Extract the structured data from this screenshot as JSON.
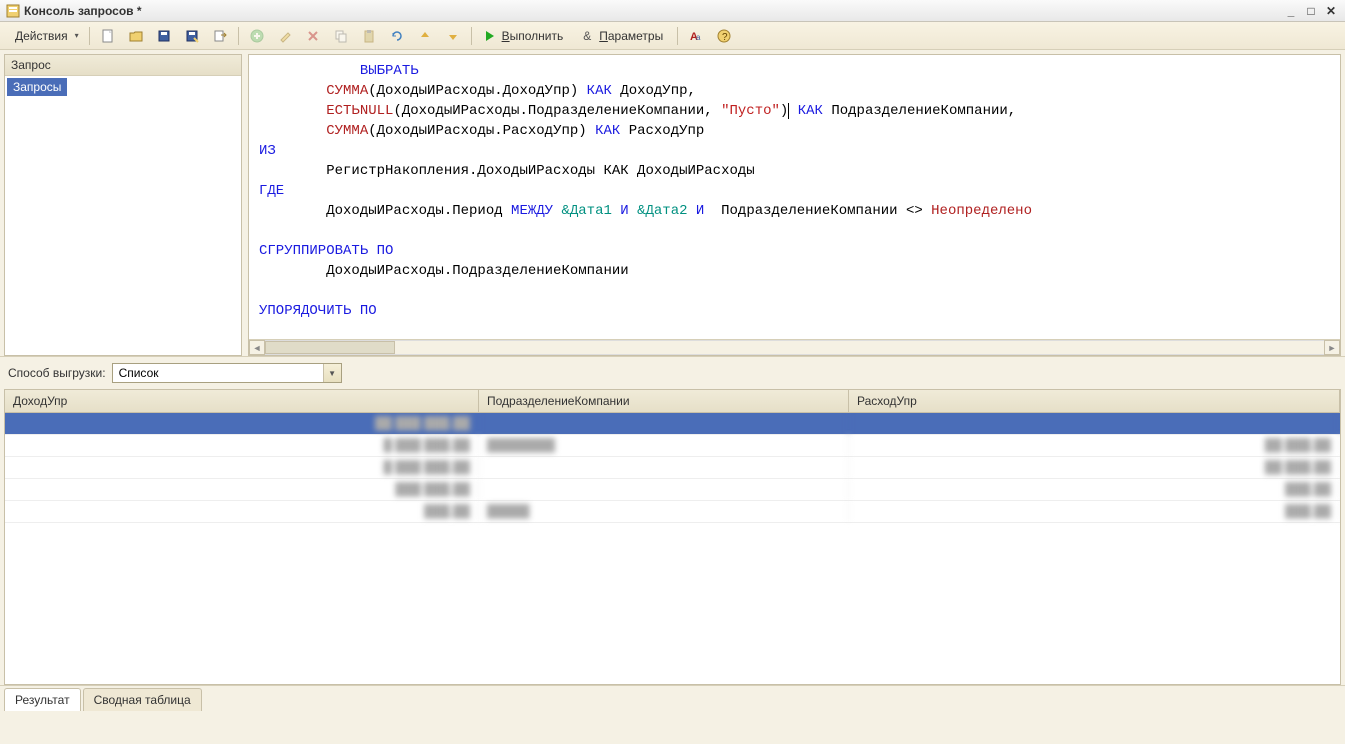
{
  "window": {
    "title": "Консоль запросов *"
  },
  "toolbar": {
    "actions_label": "Действия",
    "execute_label": "Выполнить",
    "params_label": "Параметры"
  },
  "tree": {
    "header": "Запрос",
    "item_0": "Запросы"
  },
  "query": {
    "line1_indent": "            ",
    "select_kw": "ВЫБРАТЬ",
    "sum_fn": "СУММА",
    "isnull_fn": "ЕСТЬNULL",
    "line2_indent": "        ",
    "line2_arg": "(ДоходыИРасходы.ДоходУпр) ",
    "as_kw": "КАК",
    "line2_alias": " ДоходУпр,",
    "line3_arg": "(ДоходыИРасходы.ПодразделениеКомпании, ",
    "line3_str": "\"Пусто\"",
    "line3_close": ")",
    "line3_alias": " ПодразделениеКомпании,",
    "line4_arg": "(ДоходыИРасходы.РасходУпр) ",
    "line4_alias": " РасходУпр",
    "from_kw": "ИЗ",
    "from_body": "        РегистрНакопления.ДоходыИРасходы КАК ДоходыИРасходы",
    "where_kw": "ГДЕ",
    "where_indent": "        ДоходыИРасходы.Период ",
    "between_kw": "МЕЖДУ",
    "param1": " &Дата1 ",
    "and_kw": "И",
    "param2": " &Дата2 ",
    "where_tail_1": "  ПодразделениеКомпании <> ",
    "undef": "Неопределено",
    "group_kw": "СГРУППИРОВАТЬ ПО",
    "group_body": "        ДоходыИРасходы.ПодразделениеКомпании",
    "order_kw": "УПОРЯДОЧИТЬ ПО"
  },
  "export": {
    "label": "Способ выгрузки:",
    "value": "Список"
  },
  "grid": {
    "col1": "ДоходУпр",
    "col2": "ПодразделениеКомпании",
    "col3": "РасходУпр",
    "rows": [
      {
        "c1": "██ ███ ███,██",
        "c2": "",
        "c3": ""
      },
      {
        "c1": "█ ███ ███,██",
        "c2": "████████",
        "c3": "██ ███,██"
      },
      {
        "c1": "█ ███ ███,██",
        "c2": "",
        "c3": "██ ███,██"
      },
      {
        "c1": "███ ███,██",
        "c2": "",
        "c3": "███,██"
      },
      {
        "c1": "███,██",
        "c2": "█████",
        "c3": "███,██"
      }
    ]
  },
  "tabs": {
    "result": "Результат",
    "pivot": "Сводная таблица"
  }
}
